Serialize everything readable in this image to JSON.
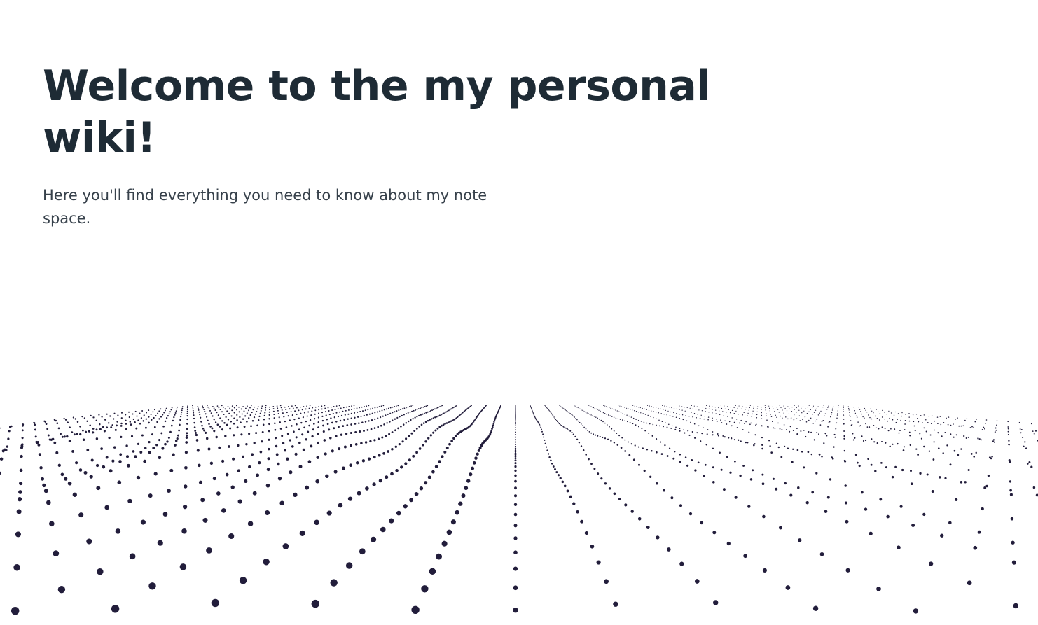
{
  "hero": {
    "title": "Welcome to the my personal wiki!",
    "subtitle": "Here you'll find everything you need to know about my note space."
  },
  "background": {
    "dot_color": "#221d3b",
    "page_color": "#ffffff",
    "heading_color": "#1e2b35",
    "text_color": "#37414b"
  }
}
